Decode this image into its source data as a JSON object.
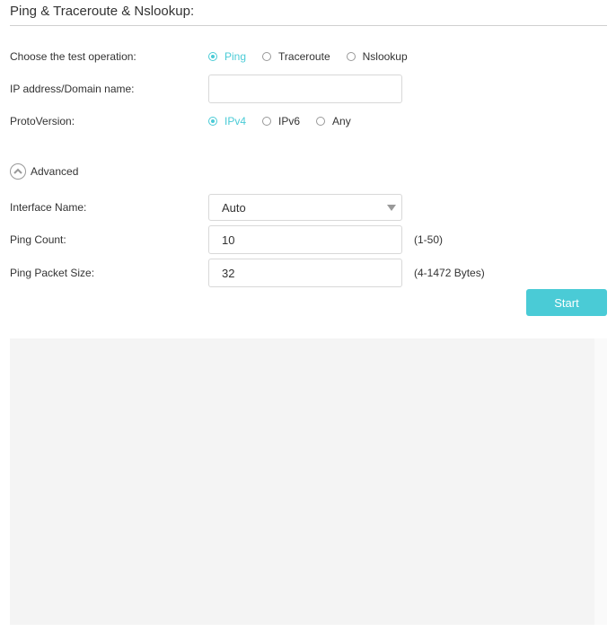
{
  "page": {
    "title": "Ping & Traceroute & Nslookup:"
  },
  "operation": {
    "label": "Choose the test operation:",
    "options": [
      "Ping",
      "Traceroute",
      "Nslookup"
    ],
    "selected": "Ping"
  },
  "address": {
    "label": "IP address/Domain name:",
    "value": "",
    "placeholder": ""
  },
  "proto": {
    "label": "ProtoVersion:",
    "options": [
      "IPv4",
      "IPv6",
      "Any"
    ],
    "selected": "IPv4"
  },
  "advanced": {
    "label": "Advanced",
    "icon": "chevron-up-icon"
  },
  "interface": {
    "label": "Interface Name:",
    "value": "Auto"
  },
  "ping_count": {
    "label": "Ping Count:",
    "value": "10",
    "hint": "(1-50)"
  },
  "packet_size": {
    "label": "Ping Packet Size:",
    "value": "32",
    "hint": "(4-1472 Bytes)"
  },
  "start": {
    "label": "Start"
  },
  "colors": {
    "accent": "#4acbd6",
    "output_bg": "#f4f4f4"
  }
}
